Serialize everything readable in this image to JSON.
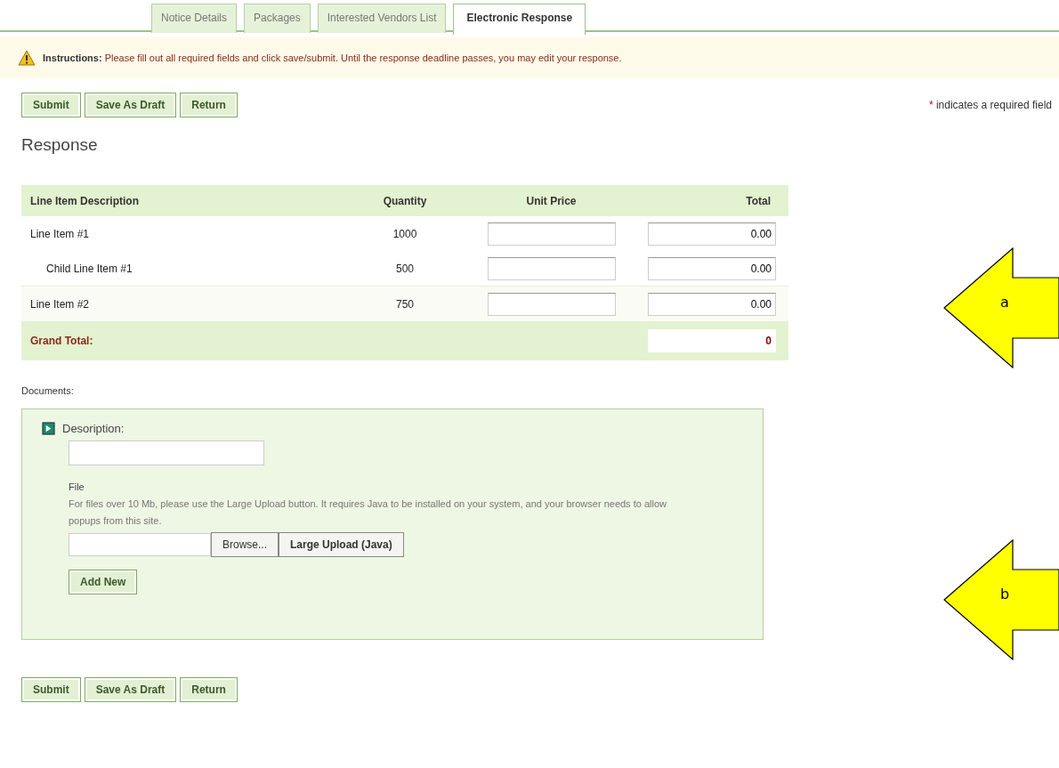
{
  "tabs": [
    {
      "label": "Notice Details",
      "selected": false
    },
    {
      "label": "Packages",
      "selected": false
    },
    {
      "label": "Interested Vendors List",
      "selected": false
    },
    {
      "label": "Electronic Response",
      "selected": true
    }
  ],
  "instructions": {
    "title": "Instructions:",
    "text": "Please fill out all required fields and click save/submit. Until the response deadline passes, you may edit your response."
  },
  "top_buttons": [
    "Submit",
    "Save As Draft",
    "Return"
  ],
  "required_note": {
    "mark": "*",
    "text": "indicates a required field"
  },
  "heading": "Response",
  "table": {
    "columns": [
      "Line Item Description",
      "Quantity",
      "Unit Price",
      "Total"
    ],
    "rows": [
      {
        "description": "Line Item #1",
        "quantity": "1000",
        "total": "0.00",
        "children": [
          {
            "description": "Child Line Item #1",
            "quantity": "500",
            "total": "0.00"
          }
        ]
      },
      {
        "description": "Line Item #2",
        "quantity": "750",
        "total": "0.00"
      }
    ],
    "grand_total": {
      "label": "Grand Total:",
      "value": "0"
    }
  },
  "documents": {
    "label": "Documents:",
    "description_label": "Desoription:",
    "file_label": "File",
    "file_help": "For files over 10 Mb, please use the Large Upload button. It requires Java to be installed on your system, and your browser needs to allow popups from this site.",
    "browse_button": "Browse...",
    "large_upload_button": "Large Upload (Java)",
    "add_button": "Add New"
  },
  "bottom_buttons": [
    "Submit",
    "Save As Draft",
    "Return"
  ],
  "callouts": [
    {
      "label": "a"
    },
    {
      "label": "b"
    }
  ]
}
